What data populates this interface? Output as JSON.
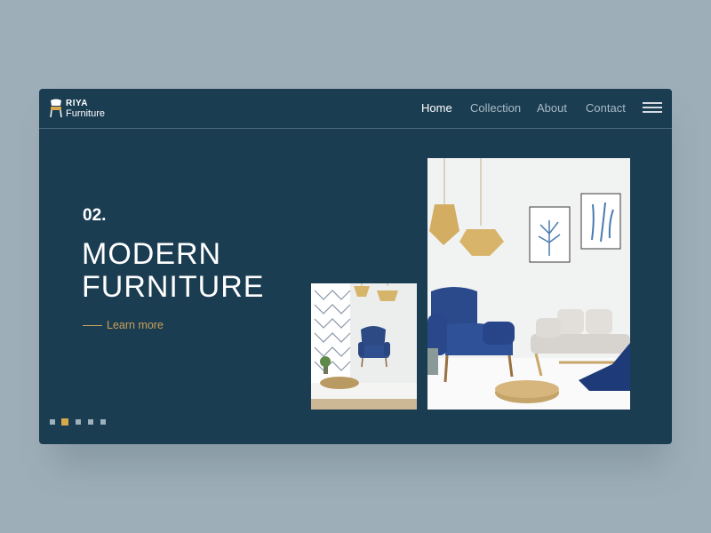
{
  "brand": {
    "line1": "RIYA",
    "line2": "Furniture",
    "icon": "chair-logo-icon"
  },
  "nav": {
    "items": [
      {
        "label": "Home",
        "active": true
      },
      {
        "label": "Collection",
        "active": false
      },
      {
        "label": "About",
        "active": false
      },
      {
        "label": "Contact",
        "active": false
      }
    ],
    "menu_icon": "hamburger-menu-icon"
  },
  "hero": {
    "slide_number": "02.",
    "title_line1": "MODERN",
    "title_line2": "FURNITURE",
    "cta_label": "Learn more"
  },
  "slider": {
    "total": 5,
    "active_index": 1
  },
  "colors": {
    "background": "#9eaeb8",
    "panel": "#1b3d52",
    "accent": "#c9a05a",
    "text": "#ffffff",
    "muted_text": "#a8b9c4"
  }
}
